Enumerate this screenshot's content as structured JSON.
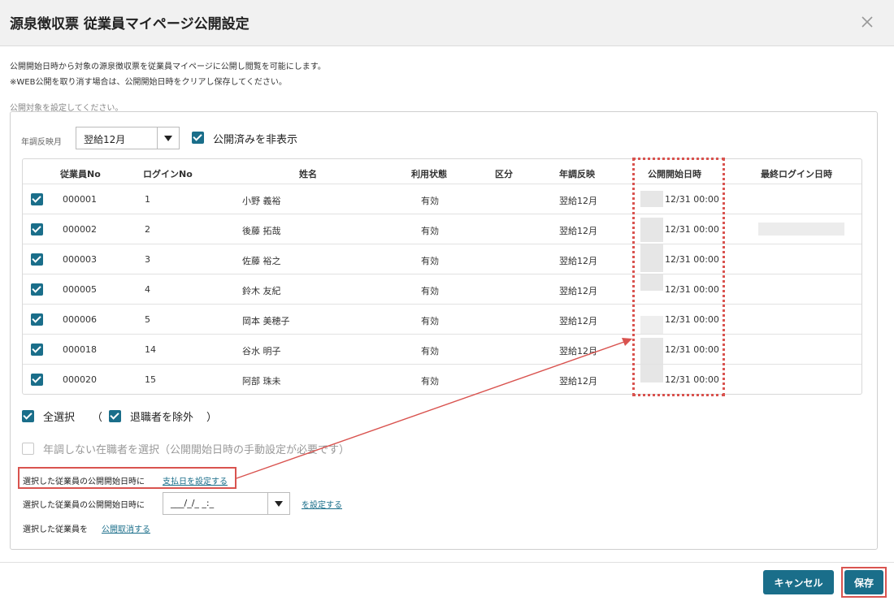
{
  "dialog": {
    "title": "源泉徴収票 従業員マイページ公開設定",
    "description_line1": "公開開始日時から対象の源泉徴収票を従業員マイページに公開し閲覧を可能にします。",
    "description_line2": "※WEB公開を取り消す場合は、公開開始日時をクリアし保存してください。",
    "target_label": "公開対象を設定してください。"
  },
  "filters": {
    "year_label": "年調反映月",
    "year_value": "翌給12月",
    "hide_published_label": "公開済みを非表示",
    "hide_published_checked": true
  },
  "table": {
    "headers": [
      "従業員No",
      "ログインNo",
      "姓名",
      "利用状態",
      "区分",
      "年調反映",
      "公開開始日時",
      "最終ログイン日時"
    ],
    "rows": [
      {
        "employee_no": "000001",
        "login_no": "1",
        "name": "小野 義裕",
        "status": "有効",
        "category": "",
        "year_adjust": "翌給12月",
        "publish_start": "12/31 00:00",
        "last_login": ""
      },
      {
        "employee_no": "000002",
        "login_no": "2",
        "name": "後藤 拓哉",
        "status": "有効",
        "category": "",
        "year_adjust": "翌給12月",
        "publish_start": "12/31 00:00",
        "last_login": ""
      },
      {
        "employee_no": "000003",
        "login_no": "3",
        "name": "佐藤 裕之",
        "status": "有効",
        "category": "",
        "year_adjust": "翌給12月",
        "publish_start": "12/31 00:00",
        "last_login": ""
      },
      {
        "employee_no": "000005",
        "login_no": "4",
        "name": "鈴木 友紀",
        "status": "有効",
        "category": "",
        "year_adjust": "翌給12月",
        "publish_start": "12/31 00:00",
        "last_login": ""
      },
      {
        "employee_no": "000006",
        "login_no": "5",
        "name": "岡本 美穂子",
        "status": "有効",
        "category": "",
        "year_adjust": "翌給12月",
        "publish_start": "12/31 00:00",
        "last_login": ""
      },
      {
        "employee_no": "000018",
        "login_no": "14",
        "name": "谷水 明子",
        "status": "有効",
        "category": "",
        "year_adjust": "翌給12月",
        "publish_start": "12/31 00:00",
        "last_login": ""
      },
      {
        "employee_no": "000020",
        "login_no": "15",
        "name": "阿部 珠未",
        "status": "有効",
        "category": "",
        "year_adjust": "翌給12月",
        "publish_start": "12/31 00:00",
        "last_login": ""
      }
    ]
  },
  "selection": {
    "select_all_label": "全選択",
    "open_paren": "（",
    "exclude_retired_label": "退職者を除外",
    "close_paren": "）",
    "non_adjusted_label": "年調しない在職者を選択（公開開始日時の手動設定が必要です）"
  },
  "actions": {
    "set_payday_prefix": "選択した従業員の公開開始日時に",
    "set_payday_link": "支払日を設定する",
    "set_datetime_prefix": "選択した従業員の公開開始日時に",
    "datetime_value": "___/_/_ _:_",
    "set_datetime_link": "を設定する",
    "cancel_prefix": "選択した従業員を",
    "cancel_publish_link": "公開取消する"
  },
  "footer": {
    "cancel_label": "キャンセル",
    "save_label": "保存"
  },
  "colors": {
    "accent": "#1a6e8a",
    "highlight": "#d9534f"
  }
}
